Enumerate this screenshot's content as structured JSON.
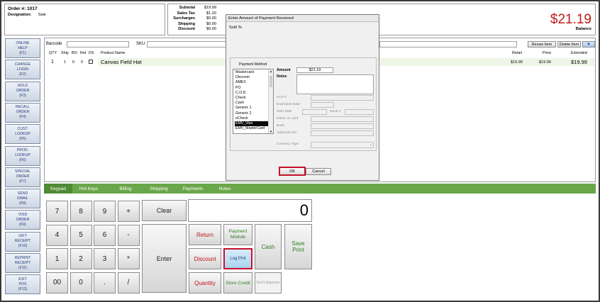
{
  "order": {
    "number_label": "Order #:",
    "number": "1017",
    "designation_label": "Designation:",
    "designation": "Sale"
  },
  "totals": [
    {
      "label": "Subtotal",
      "value": "$19.99"
    },
    {
      "label": "Sales Tax",
      "value": "$1.20"
    },
    {
      "label": "Surcharges",
      "value": "$0.00"
    },
    {
      "label": "Shipping",
      "value": "$0.00"
    },
    {
      "label": "Discount",
      "value": "$0.00"
    }
  ],
  "balance": {
    "amount": "$21.19",
    "label": "Balance"
  },
  "sidebar": [
    "ONLINE\nHELP\n(F1)",
    "CHANGE\nLOGIN\n(F2)",
    "HOLD\nORDER\n(F3)",
    "RECALL\nORDER\n(F4)",
    "CUST.\nLOOKUP\n(F5)",
    "PROD.\nLOOKUP\n(F6)",
    "SPECIAL\nORDER\n(F7)",
    "SEND\nEMAIL\n(F8)",
    "VOID\nORDER\n(F9)",
    "GIFT\nRECEIPT\n(F10)",
    "REPRINT\nRECEIPT\n(F11)",
    "EXIT\nPOS\n(F12)"
  ],
  "toolbar": {
    "barcode_label": "Barcode",
    "sku_label": "SKU",
    "revise_item": "Revise Item",
    "delete_item": "Delete Item"
  },
  "table": {
    "headers": {
      "qty": "QTY",
      "ship": "Ship",
      "bo": "BO",
      "ret": "Ret",
      "ds": "DS",
      "name": "Product Name",
      "retail": "Retail",
      "price": "Price",
      "extended": "Extended"
    },
    "rows": [
      {
        "qty": "1",
        "ship": "1",
        "bo": "0",
        "ret": "0",
        "name": "Canvas Field Hat",
        "retail": "$19.99",
        "price": "$19.99",
        "extended": "$19.99"
      }
    ]
  },
  "tabs": [
    "Keypad",
    "Hot Keys",
    "Billing",
    "Shipping",
    "Payments",
    "Notes"
  ],
  "keypad": {
    "keys": [
      "7",
      "8",
      "9",
      "+",
      "4",
      "5",
      "6",
      "-",
      "1",
      "2",
      "3",
      "*",
      "00",
      "0",
      ".",
      "/"
    ],
    "clear": "Clear",
    "enter": "Enter",
    "display": "0"
  },
  "functions": {
    "return": "Return",
    "discount": "Discount",
    "quantity": "Quantity",
    "payment_module": "Payment\nModule",
    "log_pmt": "Log Pmt",
    "store_credit": "Store Credit",
    "cash": "Cash",
    "save_print": "Save\nPrint",
    "dont_approve": "Don't Approve"
  },
  "dialog": {
    "title": "Enter Amount of Payment Received",
    "sold_to": "Sold To",
    "payment_method_label": "Payment Method",
    "methods": [
      "Mastercard",
      "Discover",
      "AMEX",
      "PO",
      "C.O.D.",
      "Check",
      "Cash",
      "Generic 1",
      "Generic 2",
      "eCheck",
      "EMV_Visa",
      "EMV_MasterCard"
    ],
    "selected_method": "EMV_Visa",
    "amount_label": "Amount",
    "amount": "$21.19",
    "notes_label": "Notes",
    "acct_label": "Acct #",
    "exp_label": "Expiration Date",
    "start_label": "Start Date",
    "issue_label": "Issue #",
    "name_label": "Name on card",
    "bank_label": "Bank",
    "approval_label": "Approval Info",
    "currency_label": "Currency Type",
    "ok": "OK",
    "cancel": "Cancel"
  },
  "colors": {
    "accent_red": "#c01818",
    "tab_green": "#6aa64a",
    "selection": "#0a0a0a",
    "highlight_border": "#c8102e"
  }
}
